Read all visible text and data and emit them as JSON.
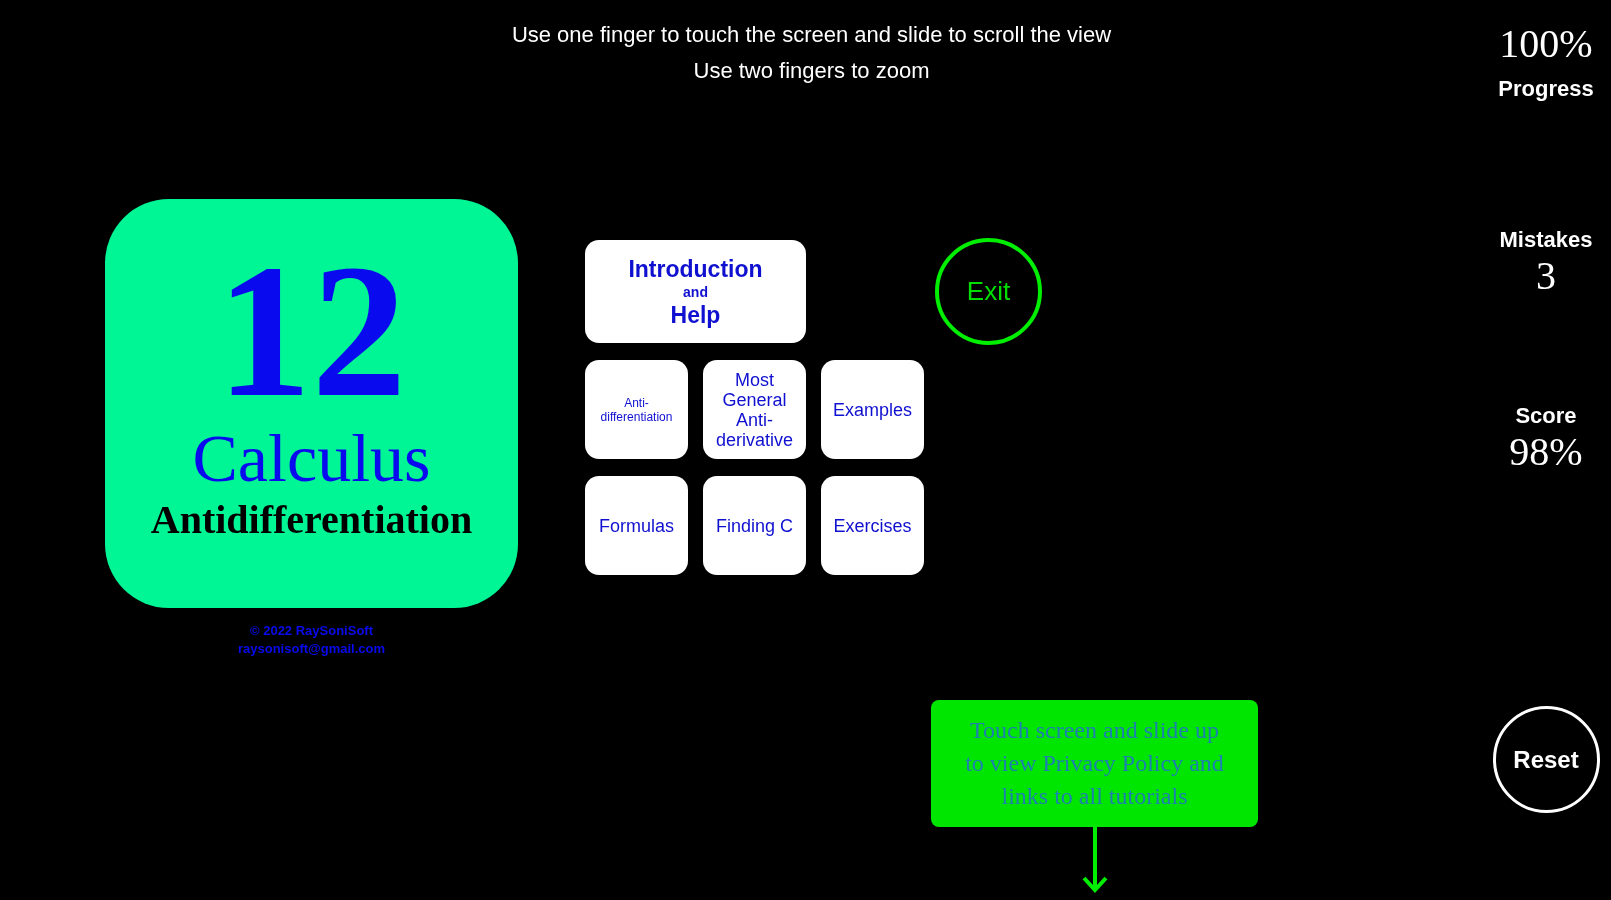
{
  "instructions": [
    "Use one finger to touch the screen and slide to scroll the view",
    "Use two fingers to zoom"
  ],
  "logo": {
    "number": "12",
    "subject": "Calculus",
    "topic": "Antidifferentiation",
    "copyright": [
      "© 2022 RaySoniSoft",
      "raysonisoft@gmail.com"
    ]
  },
  "menu": [
    {
      "kind": "wide",
      "lines": [
        {
          "text": "Introduction",
          "kind": "title"
        },
        {
          "text": "and",
          "kind": "small"
        },
        {
          "text": "Help",
          "kind": "title"
        }
      ]
    },
    {
      "kind": "tile",
      "lines": [
        {
          "text": "Anti-",
          "kind": "tiny"
        },
        {
          "text": "differentiation",
          "kind": "tiny"
        }
      ]
    },
    {
      "kind": "tile",
      "lines": [
        {
          "text": "Most",
          "kind": "normal"
        },
        {
          "text": "General",
          "kind": "normal"
        },
        {
          "text": "Anti-",
          "kind": "normal"
        },
        {
          "text": "derivative",
          "kind": "normal"
        }
      ]
    },
    {
      "kind": "tile",
      "lines": [
        {
          "text": "Examples",
          "kind": "normal"
        }
      ]
    },
    {
      "kind": "tile",
      "lines": [
        {
          "text": "Formulas",
          "kind": "normal"
        }
      ]
    },
    {
      "kind": "tile",
      "lines": [
        {
          "text": "Finding C",
          "kind": "normal"
        }
      ]
    },
    {
      "kind": "tile",
      "lines": [
        {
          "text": "Exercises",
          "kind": "normal"
        }
      ]
    }
  ],
  "exit_button": {
    "label": "Exit"
  },
  "hint": {
    "lines": [
      "Touch screen and slide up",
      "to view Privacy Policy and",
      "links to all tutorials"
    ]
  },
  "stats": [
    {
      "kind": "headline",
      "value": "100%",
      "label": "Progress"
    },
    {
      "kind": "counter",
      "label": "Mistakes",
      "value": "3"
    },
    {
      "kind": "counter",
      "label": "Score",
      "value": "98%"
    }
  ],
  "reset_button": {
    "label": "Reset"
  }
}
